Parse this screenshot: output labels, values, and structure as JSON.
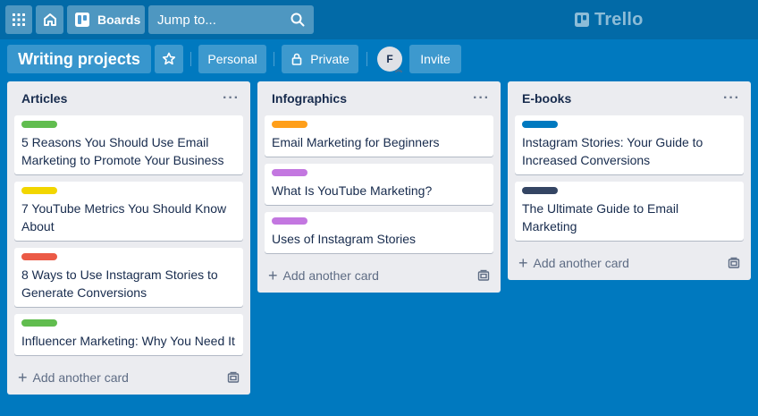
{
  "topbar": {
    "boards_label": "Boards",
    "search_placeholder": "Jump to...",
    "logo_text": "Trello"
  },
  "board": {
    "title": "Writing projects",
    "team": "Personal",
    "visibility": "Private",
    "member_initial": "F",
    "invite_label": "Invite"
  },
  "colors": {
    "background": "#0079bf",
    "green": "#61bd4f",
    "yellow": "#f2d600",
    "red": "#eb5a46",
    "orange": "#ff9f1a",
    "purple": "#c377e0",
    "blue": "#0079bf",
    "black": "#344563"
  },
  "lists": [
    {
      "title": "Articles",
      "add_card": "Add another card",
      "cards": [
        {
          "label_color": "green",
          "text": "5 Reasons You Should Use Email Marketing to Promote Your Business"
        },
        {
          "label_color": "yellow",
          "text": "7 YouTube Metrics You Should Know About"
        },
        {
          "label_color": "red",
          "text": "8 Ways to Use Instagram Stories to Generate Conversions"
        },
        {
          "label_color": "green",
          "text": "Influencer Marketing: Why You Need It"
        }
      ]
    },
    {
      "title": "Infographics",
      "add_card": "Add another card",
      "cards": [
        {
          "label_color": "orange",
          "text": "Email Marketing for Beginners"
        },
        {
          "label_color": "purple",
          "text": "What Is YouTube Marketing?"
        },
        {
          "label_color": "purple",
          "text": "Uses of Instagram Stories"
        }
      ]
    },
    {
      "title": "E-books",
      "add_card": "Add another card",
      "cards": [
        {
          "label_color": "blue",
          "text": "Instagram Stories: Your Guide to Increased Conversions"
        },
        {
          "label_color": "black",
          "text": "The Ultimate Guide to Email Marketing"
        }
      ]
    }
  ]
}
